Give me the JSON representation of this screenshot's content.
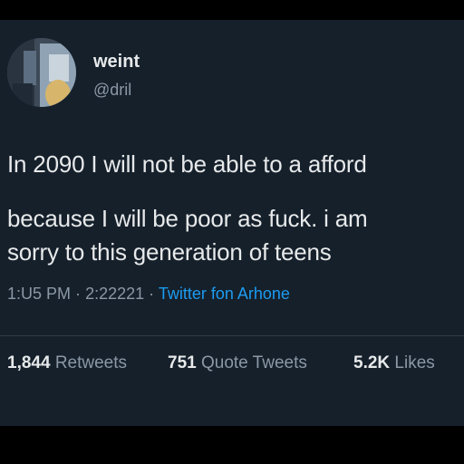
{
  "user": {
    "display_name": "weint",
    "handle": "@dril"
  },
  "tweet": {
    "lines": [
      "In 2090 I will not be able to a afford",
      "because I will be poor as fuck. i am",
      "sorry to this generation of teens"
    ]
  },
  "meta": {
    "time": "1:U5 PM",
    "separator": "·",
    "date": "2:22221",
    "source": "Twitter fon Arhone"
  },
  "stats": {
    "retweets_count": "1,844",
    "retweets_label": "Retweets",
    "quotes_count": "751",
    "quotes_label": "Quote Tweets",
    "likes_count": "5.2K",
    "likes_label": "Likes"
  },
  "colors": {
    "background": "#15202b",
    "text": "#e7e9ea",
    "secondary": "#8b98a5",
    "link": "#1d9bf0"
  }
}
